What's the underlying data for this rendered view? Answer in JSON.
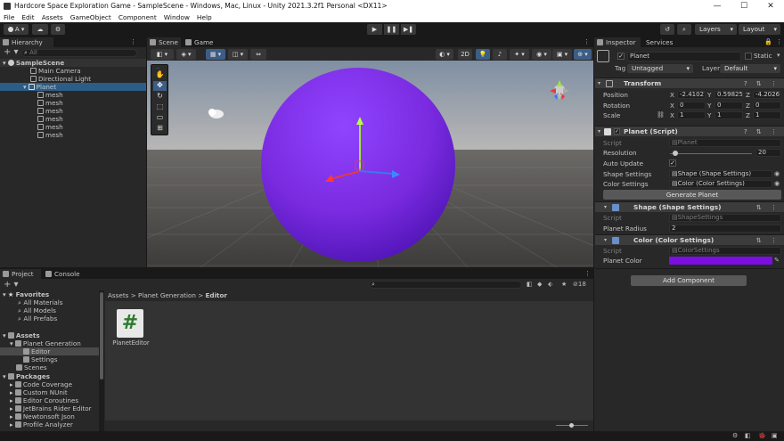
{
  "window": {
    "title": "Hardcore Space Exploration Game - SampleScene - Windows, Mac, Linux - Unity 2021.3.2f1 Personal <DX11>"
  },
  "menu": [
    "File",
    "Edit",
    "Assets",
    "GameObject",
    "Component",
    "Window",
    "Help"
  ],
  "toolbar": {
    "account": "A",
    "layers": "Layers",
    "layout": "Layout"
  },
  "hierarchy": {
    "tab": "Hierarchy",
    "search_placeholder": "All",
    "scene": "SampleScene",
    "items": [
      "Main Camera",
      "Directional Light",
      "Planet"
    ],
    "children": [
      "mesh",
      "mesh",
      "mesh",
      "mesh",
      "mesh",
      "mesh"
    ]
  },
  "scene_view": {
    "tabs": [
      "Scene",
      "Game"
    ],
    "mode_2d": "2D"
  },
  "project": {
    "tabs": [
      "Project",
      "Console"
    ],
    "favorites_label": "Favorites",
    "favorites": [
      "All Materials",
      "All Models",
      "All Prefabs"
    ],
    "assets_label": "Assets",
    "assets_tree": [
      "Planet Generation",
      "Editor",
      "Settings",
      "Scenes"
    ],
    "packages_label": "Packages",
    "packages": [
      "Code Coverage",
      "Custom NUnit",
      "Editor Coroutines",
      "JetBrains Rider Editor",
      "Newtonsoft Json",
      "Profile Analyzer"
    ],
    "breadcrumb": [
      "Assets",
      "Planet Generation",
      "Editor"
    ],
    "file_name": "PlanetEditor",
    "hidden_count": "18"
  },
  "inspector": {
    "tabs": [
      "Inspector",
      "Services"
    ],
    "object_name": "Planet",
    "static_label": "Static",
    "tag_label": "Tag",
    "tag_value": "Untagged",
    "layer_label": "Layer",
    "layer_value": "Default",
    "transform": {
      "title": "Transform",
      "position_label": "Position",
      "rotation_label": "Rotation",
      "scale_label": "Scale",
      "position": [
        "-2.41027",
        "0.598257",
        "-4.20267"
      ],
      "rotation": [
        "0",
        "0",
        "0"
      ],
      "scale": [
        "1",
        "1",
        "1"
      ]
    },
    "planet_script": {
      "title": "Planet (Script)",
      "script_label": "Script",
      "script_value": "Planet",
      "resolution_label": "Resolution",
      "resolution_value": "20",
      "resolution_fraction": 0.07,
      "auto_update_label": "Auto Update",
      "shape_settings_label": "Shape Settings",
      "shape_settings_value": "Shape (Shape Settings)",
      "color_settings_label": "Color Settings",
      "color_settings_value": "Color (Color Settings)",
      "generate_button": "Generate Planet"
    },
    "shape": {
      "title": "Shape (Shape Settings)",
      "script_label": "Script",
      "script_value": "ShapeSettings",
      "radius_label": "Planet Radius",
      "radius_value": "2"
    },
    "color": {
      "title": "Color (Color Settings)",
      "script_label": "Script",
      "script_value": "ColorSettings",
      "planet_color_label": "Planet Color",
      "planet_color": "#7a0fe0"
    },
    "add_component": "Add Component"
  },
  "axes": {
    "x": "X",
    "y": "Y",
    "z": "Z"
  },
  "colors": {
    "accent_selection": "#2c5d87",
    "planet": "#7a2be0"
  }
}
